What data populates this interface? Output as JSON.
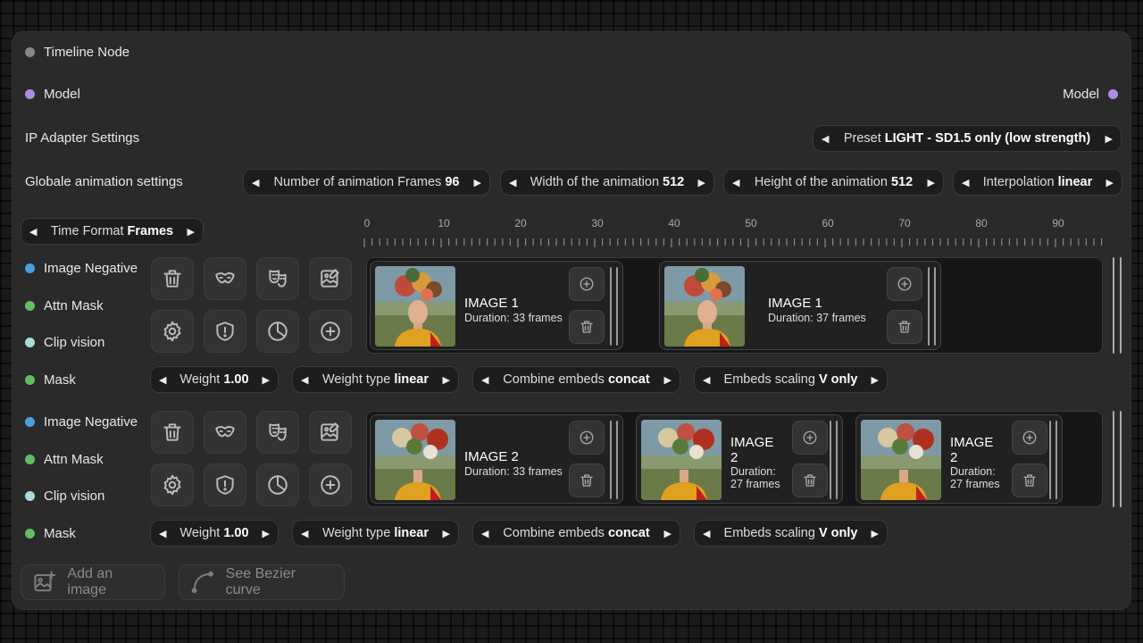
{
  "node": {
    "title": "Timeline Node",
    "model_in": "Model",
    "model_out": "Model",
    "ip_adapter_label": "IP Adapter Settings",
    "preset": {
      "label": "Preset",
      "value": "LIGHT - SD1.5 only (low strength)"
    },
    "global_label": "Globale animation settings",
    "global_settings": [
      {
        "label": "Number of animation Frames",
        "value": "96"
      },
      {
        "label": "Width of the animation",
        "value": "512"
      },
      {
        "label": "Height of the animation",
        "value": "512"
      },
      {
        "label": "Interpolation",
        "value": "linear"
      }
    ],
    "time_format": {
      "label": "Time Format",
      "value": "Frames"
    },
    "ruler_ticks": [
      "0",
      "10",
      "20",
      "30",
      "40",
      "50",
      "60",
      "70",
      "80",
      "90"
    ]
  },
  "inputs": [
    "Image Negative",
    "Attn Mask",
    "Clip vision",
    "Mask"
  ],
  "input_colors": [
    "#4a9fe0",
    "#5fbf5f",
    "#a8dcdc",
    "#5fbf5f"
  ],
  "colors": {
    "model": "#b08ae0",
    "title_dot": "#888888"
  },
  "tracks": [
    {
      "clips": [
        {
          "title": "IMAGE 1",
          "duration": "Duration: 33 frames"
        },
        {
          "title": "IMAGE 1",
          "duration": "Duration: 37 frames"
        }
      ],
      "settings": [
        {
          "label": "Weight",
          "value": "1.00"
        },
        {
          "label": "Weight type",
          "value": "linear"
        },
        {
          "label": "Combine embeds",
          "value": "concat"
        },
        {
          "label": "Embeds scaling",
          "value": "V only"
        }
      ]
    },
    {
      "clips": [
        {
          "title": "IMAGE 2",
          "duration": "Duration: 33 frames"
        },
        {
          "title": "IMAGE 2",
          "duration": "Duration: 27 frames"
        },
        {
          "title": "IMAGE 2",
          "duration": "Duration: 27 frames"
        }
      ],
      "settings": [
        {
          "label": "Weight",
          "value": "1.00"
        },
        {
          "label": "Weight type",
          "value": "linear"
        },
        {
          "label": "Combine embeds",
          "value": "concat"
        },
        {
          "label": "Embeds scaling",
          "value": "V only"
        }
      ]
    }
  ],
  "tool_icons": [
    "trash-icon",
    "mask-icon",
    "theater-masks-icon",
    "image-edit-icon",
    "gear-icon",
    "shield-alert-icon",
    "pie-chart-icon",
    "add-circle-icon"
  ],
  "footer": {
    "add_image": "Add an image",
    "bezier": "See Bezier curve"
  }
}
